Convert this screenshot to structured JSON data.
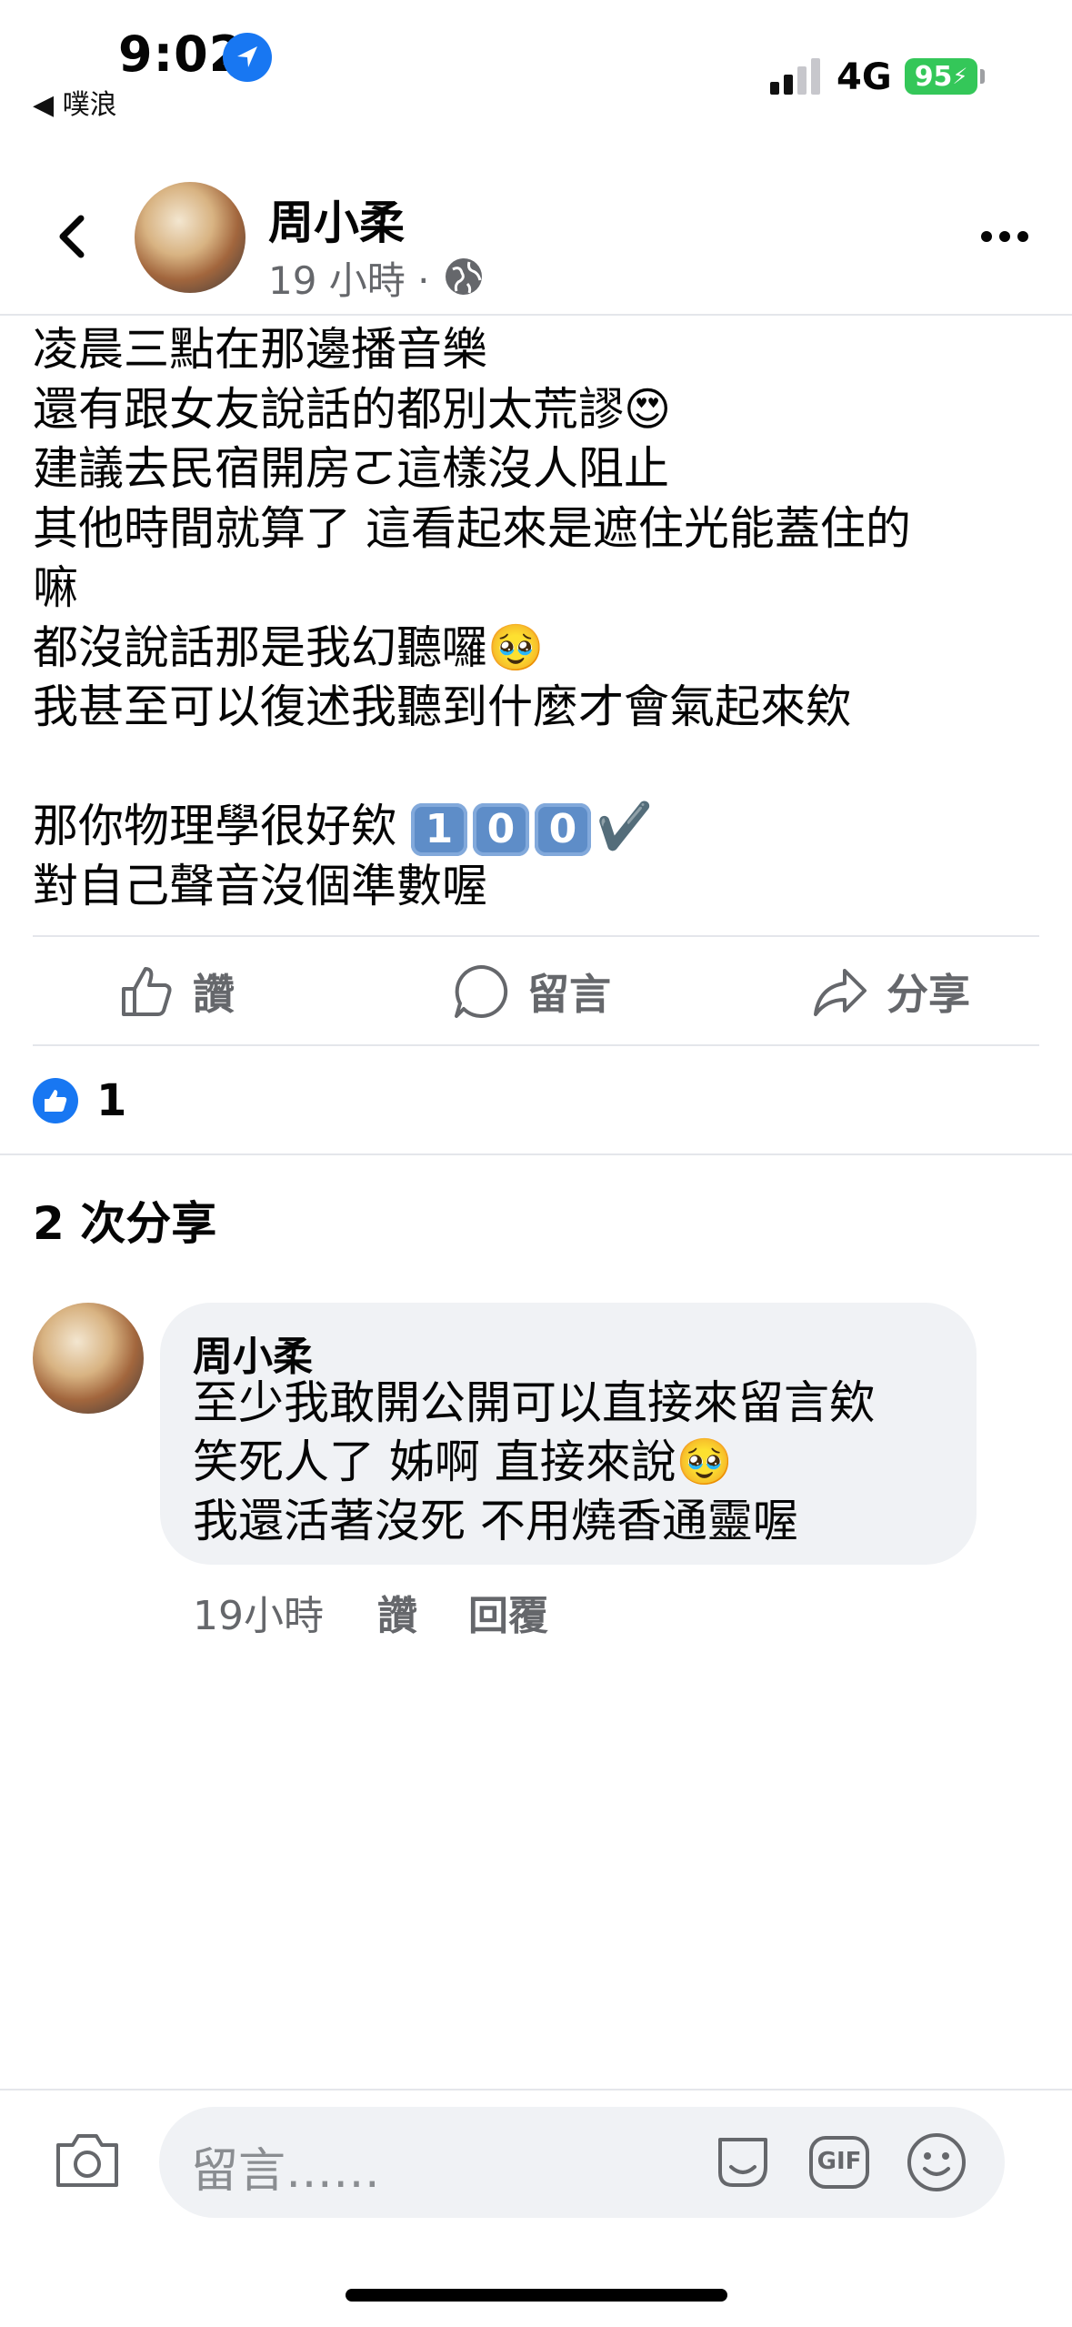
{
  "status": {
    "time": "9:02",
    "back_app": "◀ 噗浪",
    "network": "4G",
    "battery": "95"
  },
  "post": {
    "author": "周小柔",
    "time": "19 小時 ·",
    "lines": [
      "凌晨三點在那邊播音樂",
      "還有跟女友說話的都別太荒謬😍",
      "建議去民宿開房ㄛ這樣沒人阻止",
      "其他時間就算了 這看起來是遮住光能蓋住的",
      "嘛",
      "都沒說話那是我幻聽囉🥹",
      "我甚至可以復述我聽到什麼才會氣起來欸",
      "",
      "那你物理學很好欸",
      "對自己聲音沒個準數喔"
    ],
    "score_digits": [
      "1",
      "0",
      "0"
    ],
    "check": "✔️"
  },
  "actions": {
    "like": "讚",
    "comment": "留言",
    "share": "分享"
  },
  "reactions": {
    "count": "1"
  },
  "shares": {
    "text": "2 次分享"
  },
  "comment": {
    "author": "周小柔",
    "text": "至少我敢開公開可以直接來留言欸\n笑死人了 姊啊 直接來說🥹\n我還活著沒死 不用燒香通靈喔",
    "time": "19小時",
    "like": "讚",
    "reply": "回覆"
  },
  "composer": {
    "placeholder": "留言……",
    "gif": "GIF"
  },
  "colors": {
    "brand": "#1877f2",
    "battery": "#34c759",
    "bubble": "#f0f2f5"
  }
}
